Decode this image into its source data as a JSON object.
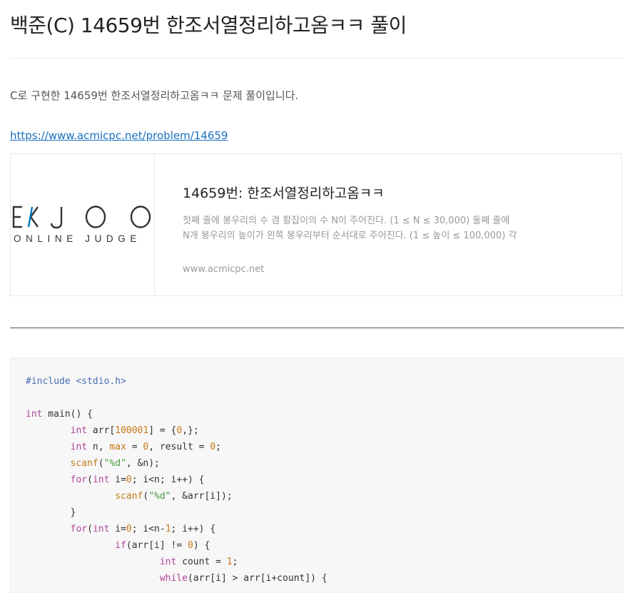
{
  "post": {
    "title": "백준(C) 14659번 한조서열정리하고옴ㅋㅋ 풀이",
    "intro": "C로 구현한 14659번 한조서열정리하고옴ㅋㅋ 문제 풀이입니다.",
    "link_text": "https://www.acmicpc.net/problem/14659"
  },
  "card": {
    "logo_text": "BAEKJOON",
    "logo_subtext": "ONLINE JUDGE",
    "title": "14659번: 한조서열정리하고옴ㅋㅋ",
    "description": "첫째 줄에 봉우리의 수 겸 활잡이의 수 N이 주어진다. (1 ≤ N ≤ 30,000) 둘째 줄에 N개 봉우리의 높이가 왼쪽 봉우리부터 순서대로 주어진다. (1 ≤ 높이 ≤ 100,000) 각각 봉우리의 높이는 중복 없이 유일하다.",
    "site": "www.acmicpc.net",
    "accent_color": "#0076c0"
  },
  "code": {
    "language": "c",
    "lines": [
      "#include <stdio.h>",
      "",
      "int main() {",
      "\tint arr[100001] = {0,};",
      "\tint n, max = 0, result = 0;",
      "\tscanf(\"%d\", &n);",
      "\tfor(int i=0; i<n; i++) {",
      "\t\tscanf(\"%d\", &arr[i]);",
      "\t}",
      "\tfor(int i=0; i<n-1; i++) {",
      "\t\tif(arr[i] != 0) {",
      "\t\t\tint count = 1;",
      "\t\t\twhile(arr[i] > arr[i+count]) {"
    ]
  }
}
